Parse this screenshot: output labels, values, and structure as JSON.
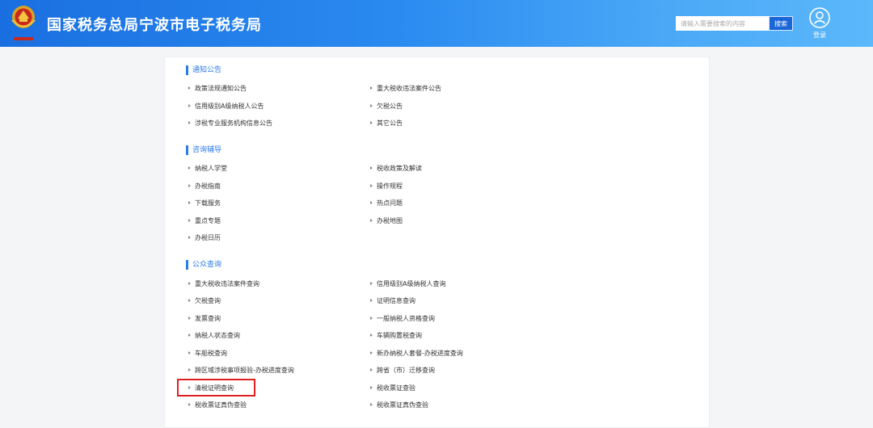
{
  "header": {
    "title": "国家税务总局宁波市电子税务局",
    "search_placeholder": "请输入需要搜索的内容",
    "search_button": "搜索",
    "login_label": "登录",
    "brand_color": "#2a8af0"
  },
  "sections": [
    {
      "title": "通知公告",
      "links": [
        "政策法规通知公告",
        "重大税收违法案件公告",
        "信用级别A级纳税人公告",
        "欠税公告",
        "涉税专业服务机构信息公告",
        "其它公告"
      ]
    },
    {
      "title": "咨询辅导",
      "links": [
        "纳税人学堂",
        "税收政策及解读",
        "办税指南",
        "操作规程",
        "下载服务",
        "热点问题",
        "重点专题",
        "办税地图",
        "办税日历"
      ]
    },
    {
      "title": "公众查询",
      "links": [
        "重大税收违法案件查询",
        "信用级别A级纳税人查询",
        "欠税查询",
        "证明信息查询",
        "发票查询",
        "一般纳税人资格查询",
        "纳税人状态查询",
        "车辆购置税查询",
        "车船税查询",
        "新办纳税人套餐-办税进度查询",
        "跨区域涉税事项报验-办税进度查询",
        "跨省（市）迁移查询",
        "清税证明查询",
        "税收票证查验",
        "税收票证真伪查验",
        "税收票证真伪查验"
      ]
    }
  ],
  "highlighted_item": "清税证明查询",
  "highlight_color": "#e02020"
}
